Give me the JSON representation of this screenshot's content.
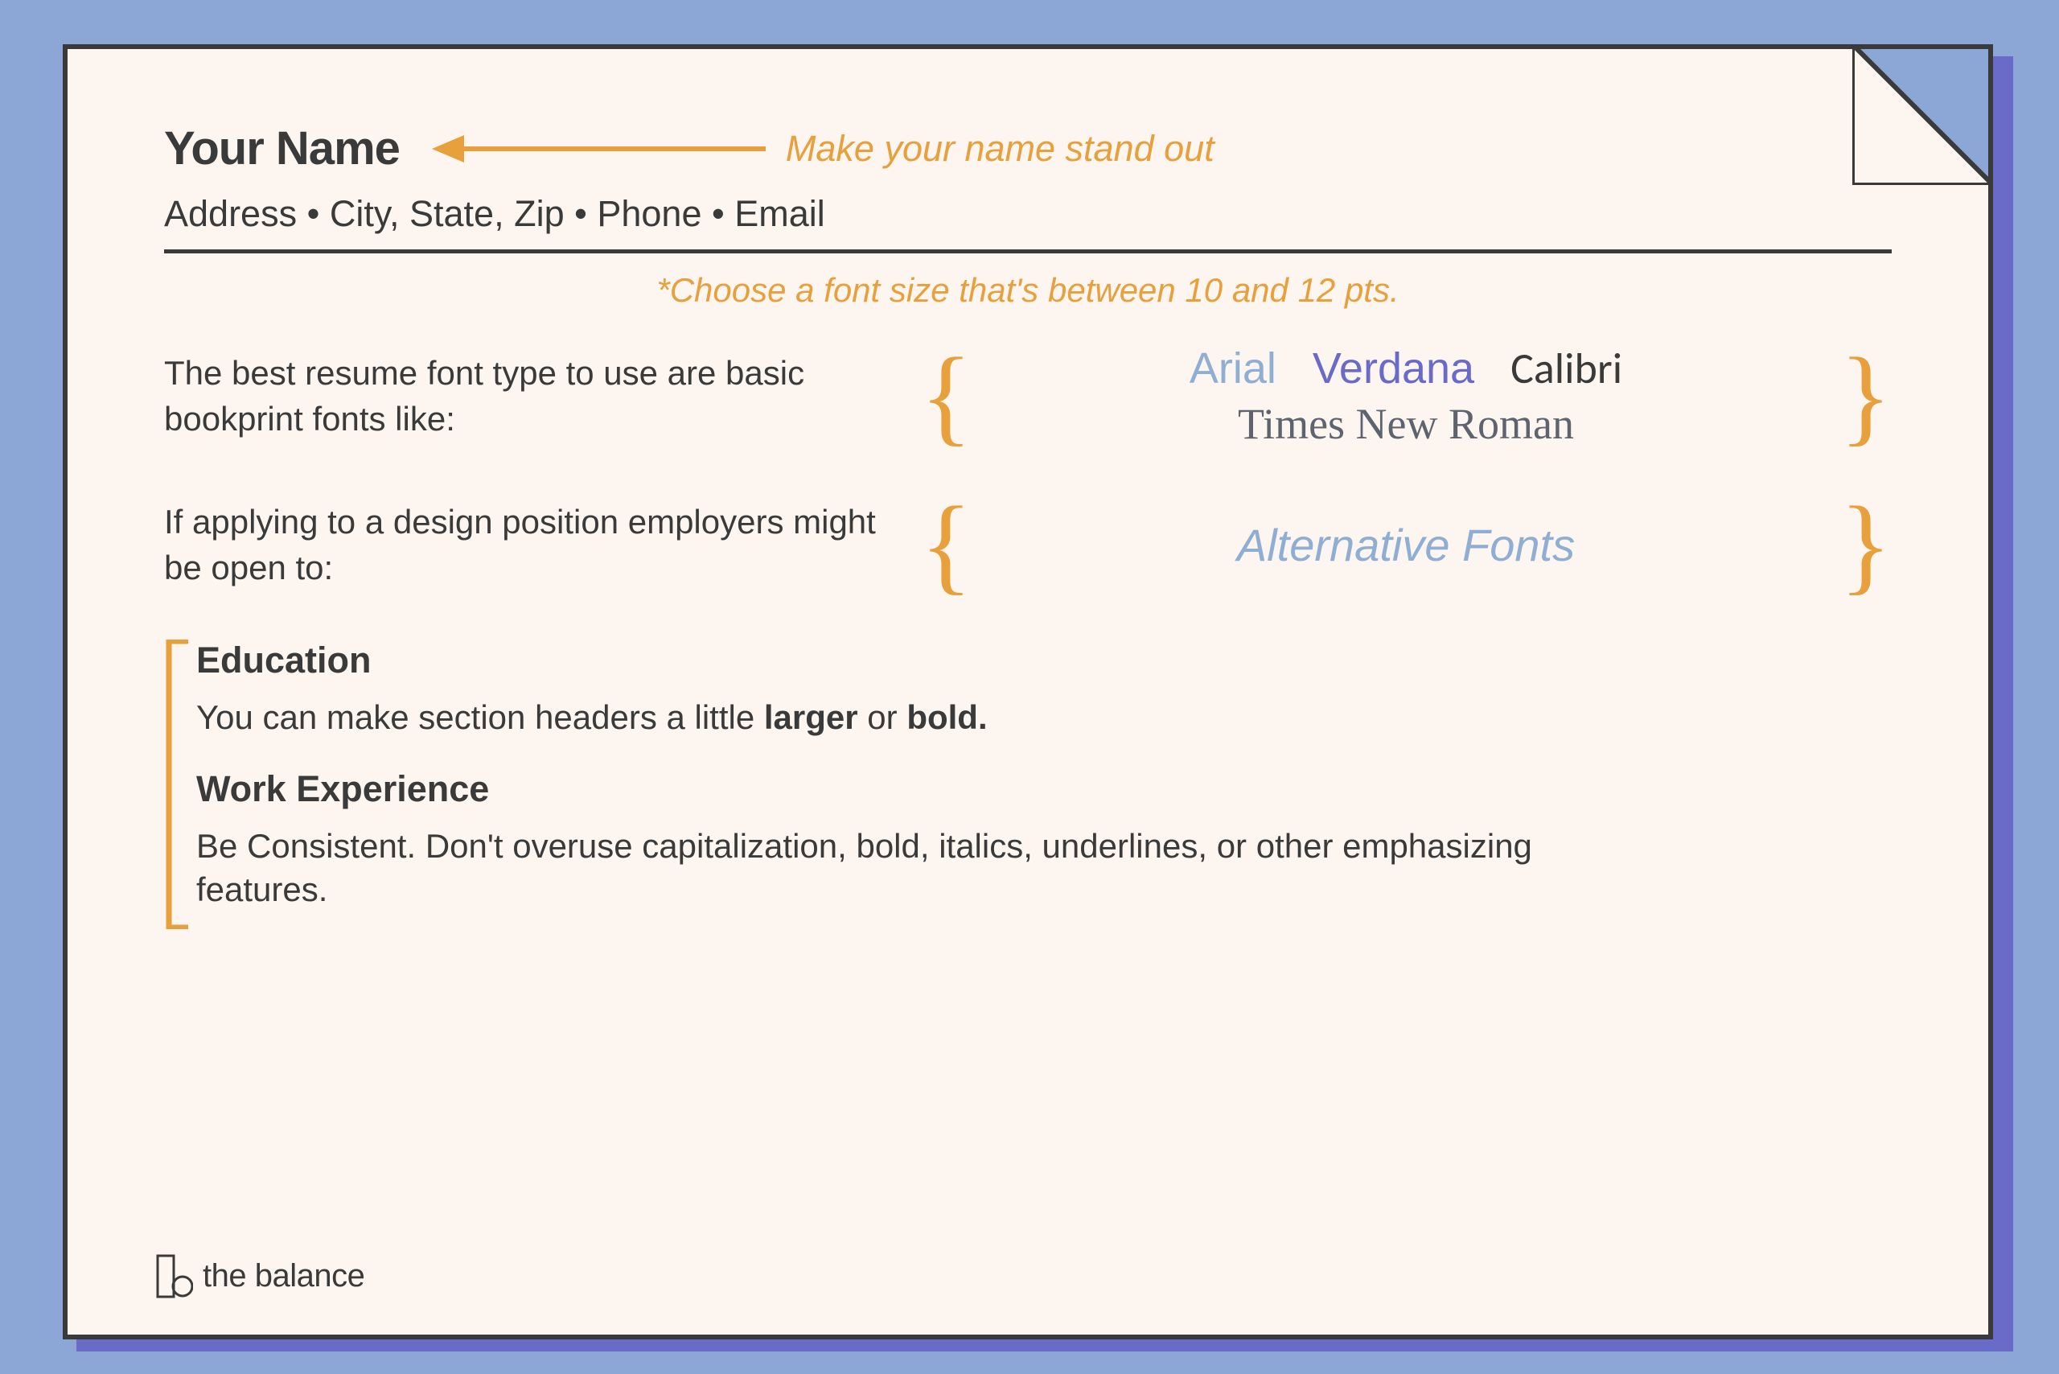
{
  "header": {
    "name": "Your Name",
    "name_tip": "Make your name stand out",
    "contact_line": "Address • City, State, Zip • Phone • Email",
    "font_size_tip": "*Choose a font size that's between 10 and 12 pts."
  },
  "font_advice": {
    "basic_label": "The best resume font type to use are basic bookprint fonts like:",
    "fonts": {
      "arial": "Arial",
      "verdana": "Verdana",
      "calibri": "Calibri",
      "times": "Times New Roman"
    },
    "design_label": "If applying to a design position employers might be open to:",
    "alt_fonts": "Alternative Fonts"
  },
  "sections": {
    "education": {
      "heading": "Education",
      "body_pre": "You can make section headers a little ",
      "body_bold1": "larger",
      "body_mid": " or ",
      "body_bold2": "bold."
    },
    "work": {
      "heading": "Work Experience",
      "body": "Be Consistent. Don't overuse capitalization, bold, italics, underlines, or other emphasizing features."
    }
  },
  "logo_text": "the balance",
  "colors": {
    "background": "#8ca7d5",
    "paper": "#fdf5ef",
    "shadow": "#6a6bc9",
    "accent": "#e7a03b",
    "ink": "#3a3a3a"
  }
}
